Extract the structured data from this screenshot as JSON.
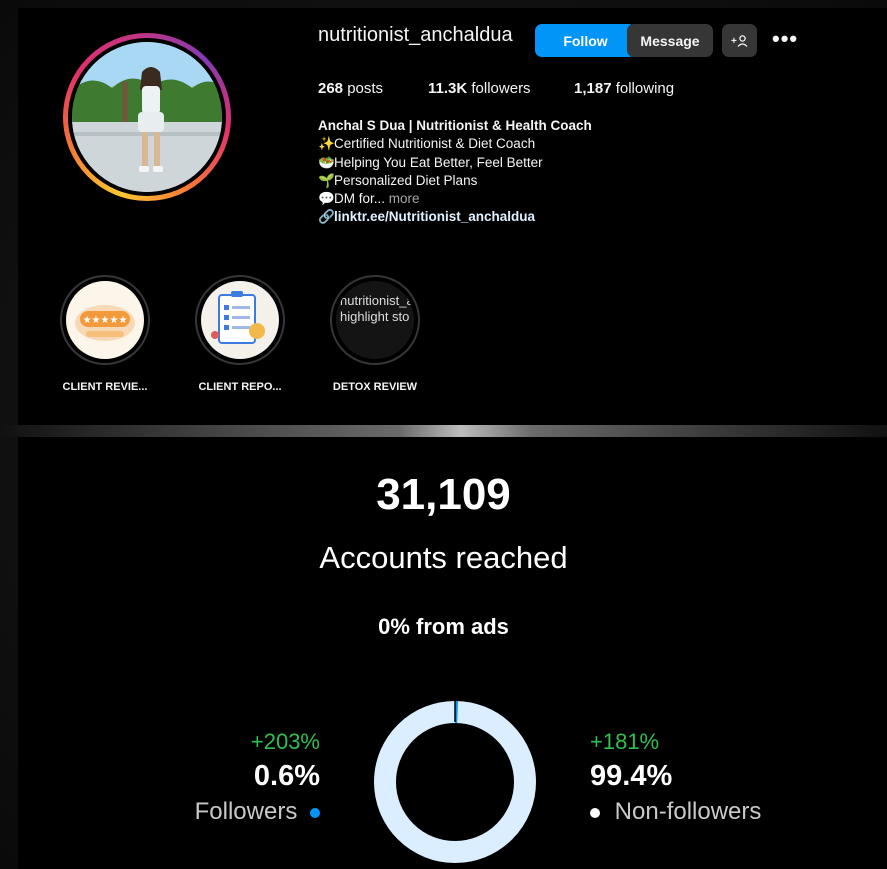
{
  "profile": {
    "username": "nutritionist_anchaldua",
    "follow_label": "Follow",
    "message_label": "Message",
    "add_label": "+",
    "more_icon": "more-icon",
    "stats": {
      "posts": "268",
      "posts_label": "posts",
      "followers": "11.3K",
      "followers_label": "followers",
      "following": "1,187",
      "following_label": "following"
    },
    "bio": {
      "name": "Anchal S Dua | Nutritionist & Health Coach",
      "lines": [
        {
          "icon": "✨",
          "text": "Certified Nutritionist & Diet Coach"
        },
        {
          "icon": "🥗",
          "text": "Helping You Eat Better, Feel Better"
        },
        {
          "icon": "🌱",
          "text": "Personalized Diet Plans"
        },
        {
          "icon": "💬",
          "text": "DM for..."
        }
      ],
      "more": "more",
      "link": "linktr.ee/Nutritionist_anchaldua"
    },
    "highlights": [
      {
        "label": "CLIENT REVIE..."
      },
      {
        "label": "CLIENT REPO..."
      },
      {
        "label": "DETOX REVIEW",
        "inner_line1": "nutritionist_a",
        "inner_line2": "highlight sto"
      }
    ]
  },
  "insights": {
    "accounts_reached": "31,109",
    "accounts_reached_label": "Accounts reached",
    "from_ads": "0% from ads",
    "followers": {
      "growth": "+203%",
      "percent": "0.6%",
      "label": "Followers",
      "color": "#0095f6"
    },
    "non_followers": {
      "growth": "+181%",
      "percent": "99.4%",
      "label": "Non-followers",
      "color": "#ffffff"
    },
    "donut_fraction_followers": 0.006,
    "donut_ring_color": "#dbeeff",
    "growth_color": "#2fbf4f"
  }
}
